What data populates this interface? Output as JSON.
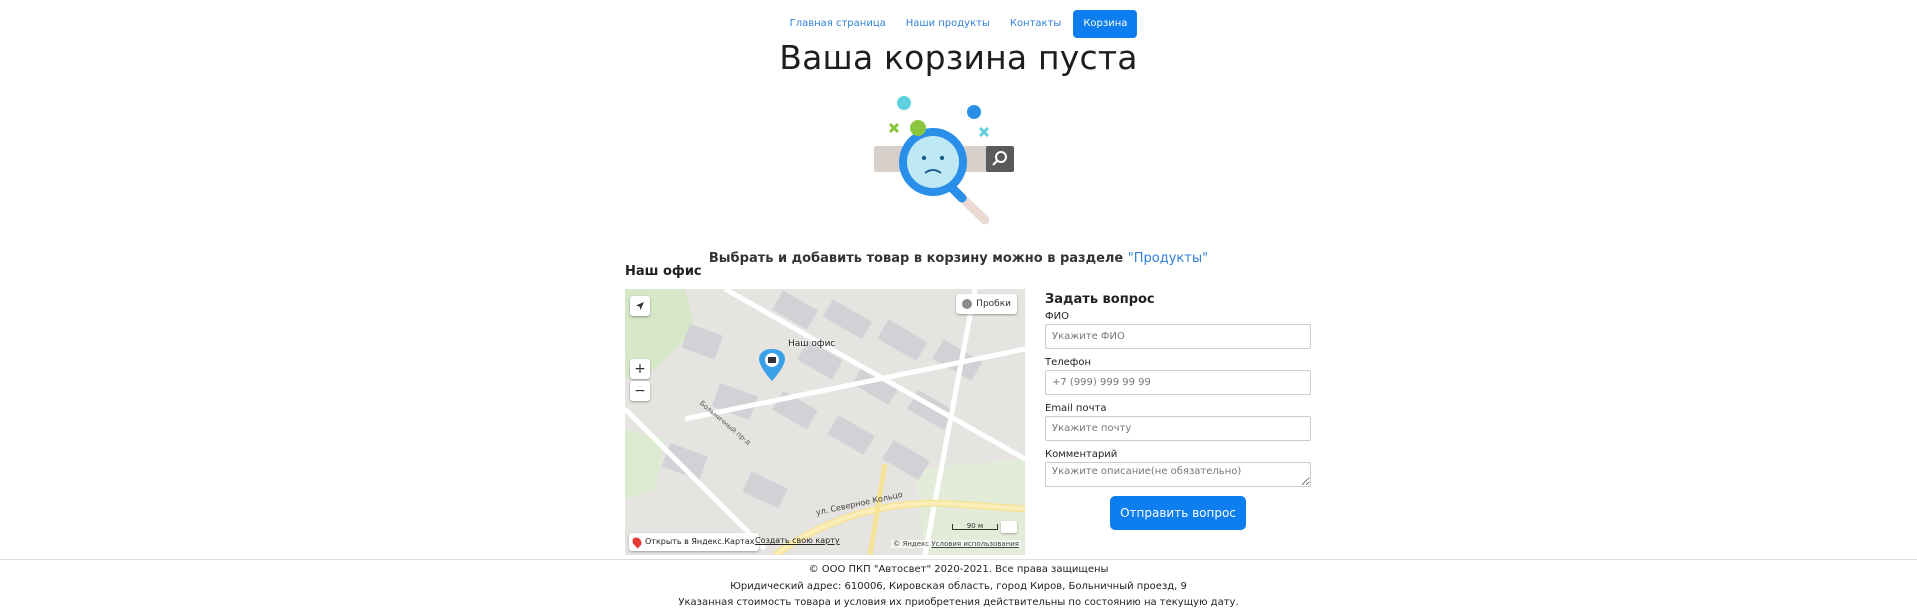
{
  "nav": {
    "items": [
      {
        "label": "Главная страница"
      },
      {
        "label": "Наши продукты"
      },
      {
        "label": "Контакты"
      },
      {
        "label": "Корзина",
        "active": true
      }
    ]
  },
  "page": {
    "title": "Ваша корзина пуста",
    "hint_text": "Выбрать и добавить товар в корзину можно в разделе ",
    "hint_link": "\"Продукты\""
  },
  "office": {
    "title": "Наш офис",
    "map": {
      "traffic_label": "Пробки",
      "pin_label": "Наш офис",
      "zoom_in": "+",
      "zoom_out": "−",
      "open_label": "Открыть в Яндекс.Картах",
      "create_label": "Создать свою карту",
      "copyright_prefix": "© Яндекс ",
      "terms_label": "Условия использования",
      "scale_label": "90 м",
      "street_1": "ул. Северное Кольцо",
      "street_2": "Больничный пр-д"
    }
  },
  "form": {
    "title": "Задать вопрос",
    "fio_label": "ФИО",
    "fio_placeholder": "Укажите ФИО",
    "phone_label": "Телефон",
    "phone_placeholder": "+7 (999) 999 99 99",
    "email_label": "Email почта",
    "email_placeholder": "Укажите почту",
    "comment_label": "Комментарий",
    "comment_placeholder": "Укажите описание(не обязательно)",
    "submit_label": "Отправить вопрос"
  },
  "footer": {
    "line1": "© ООО ПКП \"Автосвет\" 2020-2021. Все права защищены",
    "line2": "Юридический адрес: 610006, Кировская область, город Киров, Больничный проезд, 9",
    "line3": "Указанная стоимость товара и условия их приобретения действительны по состоянию на текущую дату."
  },
  "colors": {
    "accent": "#0d7ef0",
    "link": "#2f7fd8"
  }
}
